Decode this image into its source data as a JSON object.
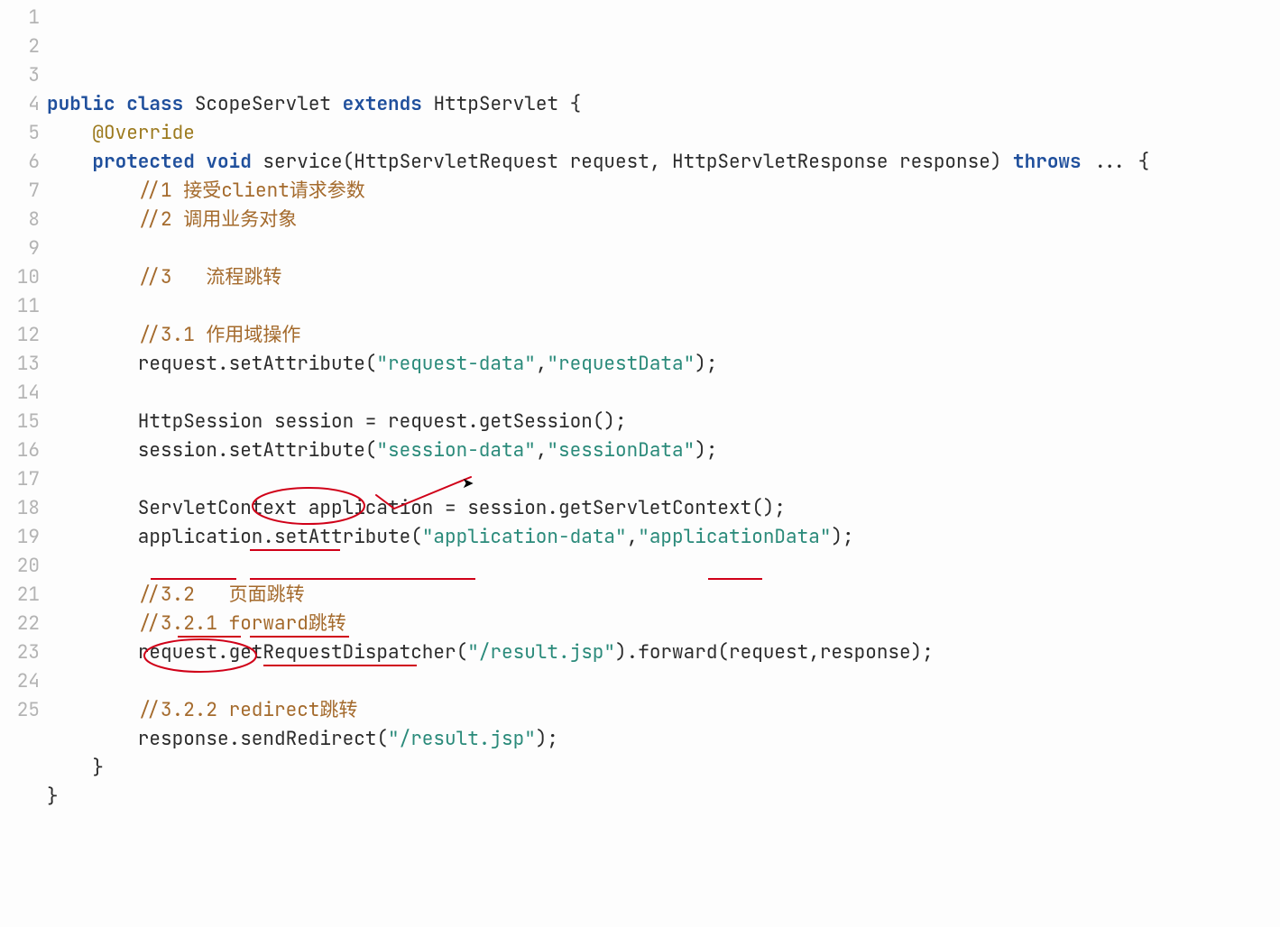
{
  "language": "Java",
  "lineCount": 25,
  "syntaxColors": {
    "keyword": "#1f4f9c",
    "annotation": "#9c7a1e",
    "comment": "#a46a2c",
    "string": "#2a8a7a",
    "plain": "#2b2b2b",
    "gutter": "#b4b4b4",
    "handAnnotation": "#d00018"
  },
  "lines": {
    "1": [
      [
        "kw",
        "public"
      ],
      [
        "plain",
        " "
      ],
      [
        "kw",
        "class"
      ],
      [
        "plain",
        " "
      ],
      [
        "classname",
        "ScopeServlet"
      ],
      [
        "plain",
        " "
      ],
      [
        "kw",
        "extends"
      ],
      [
        "plain",
        " "
      ],
      [
        "classname",
        "HttpServlet"
      ],
      [
        "plain",
        " {"
      ]
    ],
    "2": [
      [
        "plain",
        "    "
      ],
      [
        "ann",
        "@Override"
      ]
    ],
    "3": [
      [
        "plain",
        "    "
      ],
      [
        "kw",
        "protected"
      ],
      [
        "plain",
        " "
      ],
      [
        "kw",
        "void"
      ],
      [
        "plain",
        " service(HttpServletRequest request, HttpServletResponse response) "
      ],
      [
        "kw",
        "throws"
      ],
      [
        "plain",
        " "
      ],
      [
        "ellipsis",
        "..."
      ],
      [
        "plain",
        " {"
      ]
    ],
    "4": [
      [
        "plain",
        "        "
      ],
      [
        "comment",
        "//1 接受client请求参数"
      ]
    ],
    "5": [
      [
        "plain",
        "        "
      ],
      [
        "comment",
        "//2 调用业务对象"
      ]
    ],
    "6": [
      [
        "plain",
        ""
      ]
    ],
    "7": [
      [
        "plain",
        "        "
      ],
      [
        "comment",
        "//3   流程跳转"
      ]
    ],
    "8": [
      [
        "plain",
        ""
      ]
    ],
    "9": [
      [
        "plain",
        "        "
      ],
      [
        "comment",
        "//3.1 作用域操作"
      ]
    ],
    "10": [
      [
        "plain",
        "        request.setAttribute("
      ],
      [
        "str",
        "\"request-data\""
      ],
      [
        "plain",
        ","
      ],
      [
        "str",
        "\"requestData\""
      ],
      [
        "plain",
        ");"
      ]
    ],
    "11": [
      [
        "plain",
        ""
      ]
    ],
    "12": [
      [
        "plain",
        "        HttpSession session = request.getSession();"
      ]
    ],
    "13": [
      [
        "plain",
        "        session.setAttribute("
      ],
      [
        "str",
        "\"session-data\""
      ],
      [
        "plain",
        ","
      ],
      [
        "str",
        "\"sessionData\""
      ],
      [
        "plain",
        ");"
      ]
    ],
    "14": [
      [
        "plain",
        ""
      ]
    ],
    "15": [
      [
        "plain",
        "        ServletContext application = session.getServletContext();"
      ]
    ],
    "16": [
      [
        "plain",
        "        application.setAttribute("
      ],
      [
        "str",
        "\"application-data\""
      ],
      [
        "plain",
        ","
      ],
      [
        "str",
        "\"applicationData\""
      ],
      [
        "plain",
        ");"
      ]
    ],
    "17": [
      [
        "plain",
        ""
      ]
    ],
    "18": [
      [
        "plain",
        "        "
      ],
      [
        "comment",
        "//3.2   页面跳转"
      ]
    ],
    "19": [
      [
        "plain",
        "        "
      ],
      [
        "comment",
        "//3.2.1 forward跳转"
      ]
    ],
    "20": [
      [
        "plain",
        "        request.getRequestDispatcher("
      ],
      [
        "str",
        "\"/result.jsp\""
      ],
      [
        "plain",
        ").forward(request,response);"
      ]
    ],
    "21": [
      [
        "plain",
        ""
      ]
    ],
    "22": [
      [
        "plain",
        "        "
      ],
      [
        "comment",
        "//3.2.2 redirect跳转"
      ]
    ],
    "23": [
      [
        "plain",
        "        response.sendRedirect("
      ],
      [
        "str",
        "\"/result.jsp\""
      ],
      [
        "plain",
        ");"
      ]
    ],
    "24": [
      [
        "plain",
        "    }"
      ]
    ],
    "25": [
      [
        "plain",
        "}"
      ]
    ]
  },
  "handAnnotations": {
    "description": "Red pen marks over the code",
    "shapes": [
      {
        "kind": "circle",
        "around": "页面跳转 (line 18 comment tail)"
      },
      {
        "kind": "arrow-check",
        "from": "near line 16/17 area",
        "to": "页面跳转 circle"
      },
      {
        "kind": "underline",
        "text": "forward (line 19 comment)"
      },
      {
        "kind": "underline",
        "text": "request (line 20)"
      },
      {
        "kind": "underline",
        "text": "getRequestDispatcher (line 20)"
      },
      {
        "kind": "underline",
        "text": "forward (line 20)"
      },
      {
        "kind": "underline",
        "text": "3.2.2 (line 22 comment)"
      },
      {
        "kind": "underline",
        "text": "redirect (line 22 comment)"
      },
      {
        "kind": "circle",
        "around": "response (line 23)"
      },
      {
        "kind": "underline",
        "text": "sendRedirect (line 23)"
      }
    ]
  },
  "cursor": {
    "visible": true,
    "approxLine": 17,
    "approxCol": 30
  }
}
